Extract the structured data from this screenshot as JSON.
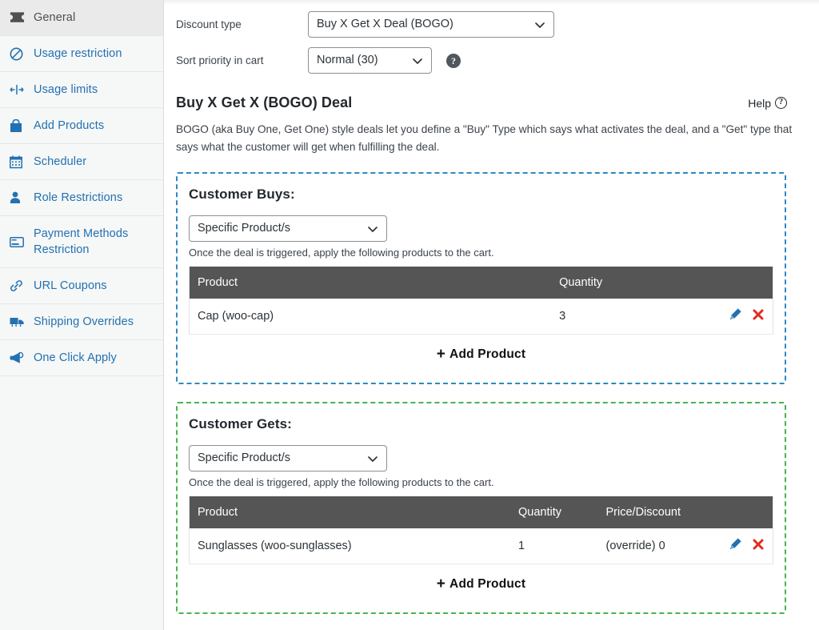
{
  "sidebar": {
    "items": [
      {
        "label": "General",
        "icon": "ticket-icon",
        "active": true
      },
      {
        "label": "Usage restriction",
        "icon": "no-entry-icon",
        "active": false
      },
      {
        "label": "Usage limits",
        "icon": "limits-icon",
        "active": false
      },
      {
        "label": "Add Products",
        "icon": "bag-icon",
        "active": false
      },
      {
        "label": "Scheduler",
        "icon": "calendar-icon",
        "active": false
      },
      {
        "label": "Role Restrictions",
        "icon": "user-icon",
        "active": false
      },
      {
        "label": "Payment Methods Restriction",
        "icon": "credit-card-icon",
        "active": false
      },
      {
        "label": "URL Coupons",
        "icon": "link-icon",
        "active": false
      },
      {
        "label": "Shipping Overrides",
        "icon": "truck-icon",
        "active": false
      },
      {
        "label": "One Click Apply",
        "icon": "megaphone-icon",
        "active": false
      }
    ]
  },
  "form": {
    "discount_type": {
      "label": "Discount type",
      "value": "Buy X Get X Deal (BOGO)",
      "options": [
        "Buy X Get X Deal (BOGO)"
      ]
    },
    "sort_priority": {
      "label": "Sort priority in cart",
      "value": "Normal (30)",
      "options": [
        "Normal (30)"
      ],
      "help_icon": "question-mark-icon"
    }
  },
  "section": {
    "title": "Buy X Get X (BOGO) Deal",
    "help_label": "Help",
    "help_icon": "question-circle-icon",
    "description": "BOGO (aka Buy One, Get One) style deals let you define a \"Buy\" Type which says what activates the deal, and a \"Get\" type that says what the customer will get when fulfilling the deal."
  },
  "buys_panel": {
    "title": "Customer Buys:",
    "border_color": "#2f88c4",
    "type_select": {
      "value": "Specific Product/s",
      "options": [
        "Specific Product/s"
      ]
    },
    "note": "Once the deal is triggered, apply the following products to the cart.",
    "columns": [
      "Product",
      "Quantity"
    ],
    "rows": [
      {
        "product": "Cap (woo-cap)",
        "quantity": "3",
        "edit_icon": "pencil-icon",
        "delete_icon": "x-delete-icon"
      }
    ],
    "add_label": "Add Product",
    "add_icon": "plus-icon"
  },
  "gets_panel": {
    "title": "Customer Gets:",
    "border_color": "#46b450",
    "type_select": {
      "value": "Specific Product/s",
      "options": [
        "Specific Product/s"
      ]
    },
    "note": "Once the deal is triggered, apply the following products to the cart.",
    "columns": [
      "Product",
      "Quantity",
      "Price/Discount"
    ],
    "rows": [
      {
        "product": "Sunglasses (woo-sunglasses)",
        "quantity": "1",
        "price_discount": "(override) 0",
        "edit_icon": "pencil-icon",
        "delete_icon": "x-delete-icon"
      }
    ],
    "add_label": "Add Product",
    "add_icon": "plus-icon"
  },
  "colors": {
    "link": "#2271b1",
    "buys_border": "#2f88c4",
    "gets_border": "#46b450",
    "table_header_bg": "#555555",
    "delete_red": "#e02b20",
    "edit_blue": "#2271b1"
  }
}
